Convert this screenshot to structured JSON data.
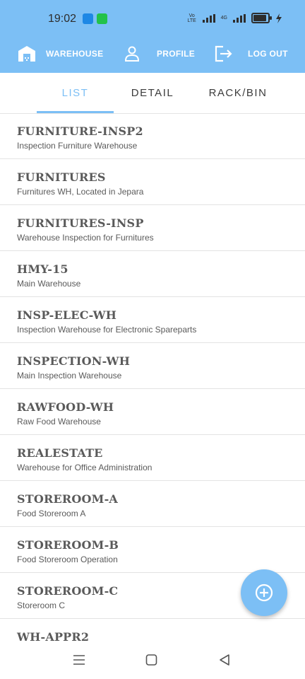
{
  "status_bar": {
    "time": "19:02",
    "volte": "Vo LTE",
    "network": "4G"
  },
  "nav": {
    "warehouse_label": "WAREHOUSE",
    "profile_label": "PROFILE",
    "logout_label": "LOG OUT"
  },
  "tabs": [
    {
      "label": "LIST",
      "active": true
    },
    {
      "label": "DETAIL",
      "active": false
    },
    {
      "label": "RACK/BIN",
      "active": false
    }
  ],
  "warehouses": [
    {
      "code": "FURNITURE-INSP2",
      "description": "Inspection Furniture Warehouse"
    },
    {
      "code": "FURNITURES",
      "description": "Furnitures WH, Located in Jepara"
    },
    {
      "code": "FURNITURES-INSP",
      "description": "Warehouse Inspection for Furnitures"
    },
    {
      "code": "HMY-15",
      "description": "Main Warehouse"
    },
    {
      "code": "INSP-ELEC-WH",
      "description": "Inspection Warehouse for Electronic Spareparts"
    },
    {
      "code": "INSPECTION-WH",
      "description": "Main Inspection Warehouse"
    },
    {
      "code": "RAWFOOD-WH",
      "description": "Raw Food Warehouse"
    },
    {
      "code": "REALESTATE",
      "description": "Warehouse for Office Administration"
    },
    {
      "code": "STOREROOM-A",
      "description": "Food Storeroom A"
    },
    {
      "code": "STOREROOM-B",
      "description": "Food Storeroom Operation"
    },
    {
      "code": "STOREROOM-C",
      "description": "Storeroom C"
    },
    {
      "code": "WH-APPR2",
      "description": ""
    }
  ],
  "colors": {
    "accent": "#7cbff5",
    "text": "#5a5a5a",
    "divider": "#e3e3e3"
  }
}
